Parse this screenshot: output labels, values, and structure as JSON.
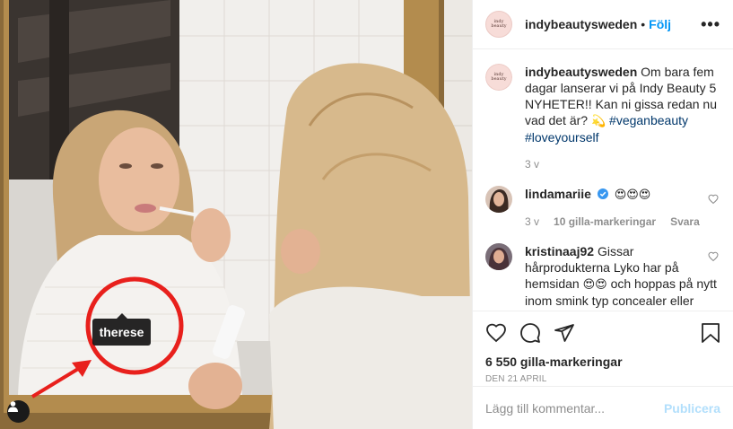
{
  "photo": {
    "tag_label": "therese"
  },
  "header": {
    "username": "indybeautysweden",
    "separator": "•",
    "follow_label": "Följ",
    "more_label": "•••",
    "avatar_text": "indy beauty"
  },
  "caption": {
    "username": "indybeautysweden",
    "text": "Om bara fem dagar lanserar vi på Indy Beauty 5 NYHETER!! Kan ni gissa redan nu vad det är?",
    "emoji": "💫",
    "hashtag1": "#veganbeauty",
    "hashtag2": "#loveyourself",
    "time": "3 v"
  },
  "comments": [
    {
      "username": "lindamariie",
      "text": "😍😍😍",
      "time": "3 v",
      "likes": "10 gilla-markeringar",
      "reply": "Svara"
    },
    {
      "username": "kristinaaj92",
      "text_a": "Gissar hårprodukterna Lyko har på hemsidan",
      "emoji_a": "😍😍",
      "text_b": "och hoppas på nytt inom smink typ concealer eller foundation",
      "emoji_b": "😍"
    }
  ],
  "actions": {
    "likes": "6 550 gilla-markeringar",
    "date": "DEN 21 APRIL"
  },
  "add_comment": {
    "placeholder": "Lägg till kommentar...",
    "publish_label": "Publicera"
  },
  "colors": {
    "accent": "#0095f6",
    "publish_disabled": "#b2dffc",
    "verified": "#3897f0",
    "annotation_red": "#e8201c"
  }
}
